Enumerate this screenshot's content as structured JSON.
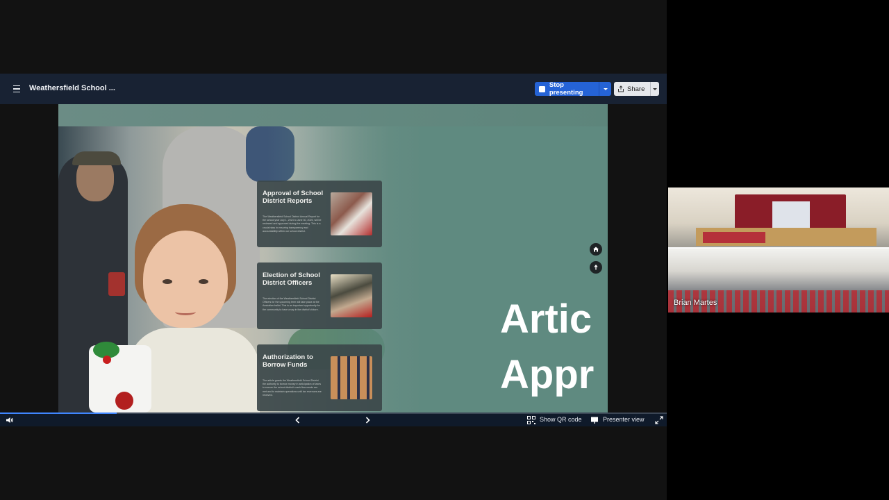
{
  "header": {
    "title": "Weathersfield School ...",
    "stop_label": "Stop presenting",
    "share_label": "Share"
  },
  "slide": {
    "cards": [
      {
        "title": "Approval of School District Reports",
        "body": "The Weathersfield School District Annual Report for the school year July 1, 2024 to June 30, 2025, will be reviewed and approved during the meeting. This is a crucial step in ensuring transparency and accountability within our school district."
      },
      {
        "title": "Election of School District Officers",
        "body": "The election of the Weathersfield School District Officers for the upcoming term will take place at the Australian ballot. This is an important opportunity for the community to have a say in the district's future."
      },
      {
        "title": "Authorization to Borrow Funds",
        "body": "The article grants the Weathersfield School District the authority to borrow money in anticipation of taxes to ensure the school district's cash flow needs are met and to maintain operations until tax revenues are received."
      }
    ],
    "big_title_line1": "Artic",
    "big_title_line2": "Appr"
  },
  "bottombar": {
    "qr_label": "Show QR code",
    "presenter_label": "Presenter view",
    "progress": 0.175
  },
  "participant": {
    "name": "Brian Martes"
  },
  "icons": {
    "menu": "menu-icon",
    "volume": "volume-icon",
    "prev": "chevron-left-icon",
    "next": "chevron-right-icon",
    "qr": "qr-code-icon",
    "presenter": "presenter-icon",
    "fullscreen": "fullscreen-icon",
    "home": "home-icon",
    "back": "back-icon",
    "share": "share-icon"
  },
  "colors": {
    "topbar": "#182233",
    "stop_button": "#2563d6",
    "slide_bg": "#5f8a80",
    "progress_fill": "#3f86ff"
  }
}
